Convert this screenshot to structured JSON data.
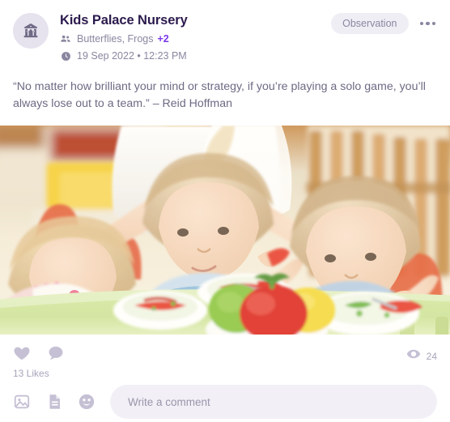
{
  "header": {
    "avatar_icon": "school-building-icon",
    "title": "Kids Palace Nursery",
    "rooms_icon": "people-group-icon",
    "rooms": "Butterflies, Frogs",
    "rooms_more": "+2",
    "time_icon": "clock-icon",
    "datetime": "19 Sep 2022 • 12:23 PM",
    "badge": "Observation",
    "more_icon": "ellipsis-horizontal-icon",
    "accent_color": "#7b37e8",
    "title_color": "#2b1a4d",
    "muted_color": "#8b86a0"
  },
  "post": {
    "quote": "“No matter how brilliant your mind or strategy, if you’re playing a solo game, you’ll always lose out to a team.” – Reid Hoffman",
    "photo_alt": "Three toddlers sitting at a green table eating bowls of tomato and cucumber salad while a carer in white stands behind them"
  },
  "actions": {
    "like_icon": "heart-icon",
    "comment_icon": "speech-bubble-icon",
    "likes_label": "13 Likes",
    "views_icon": "eye-icon",
    "views_count": "24"
  },
  "comment_bar": {
    "image_icon": "image-icon",
    "note_icon": "document-note-icon",
    "emoji_icon": "smiley-face-icon",
    "placeholder": "Write a comment",
    "value": ""
  }
}
